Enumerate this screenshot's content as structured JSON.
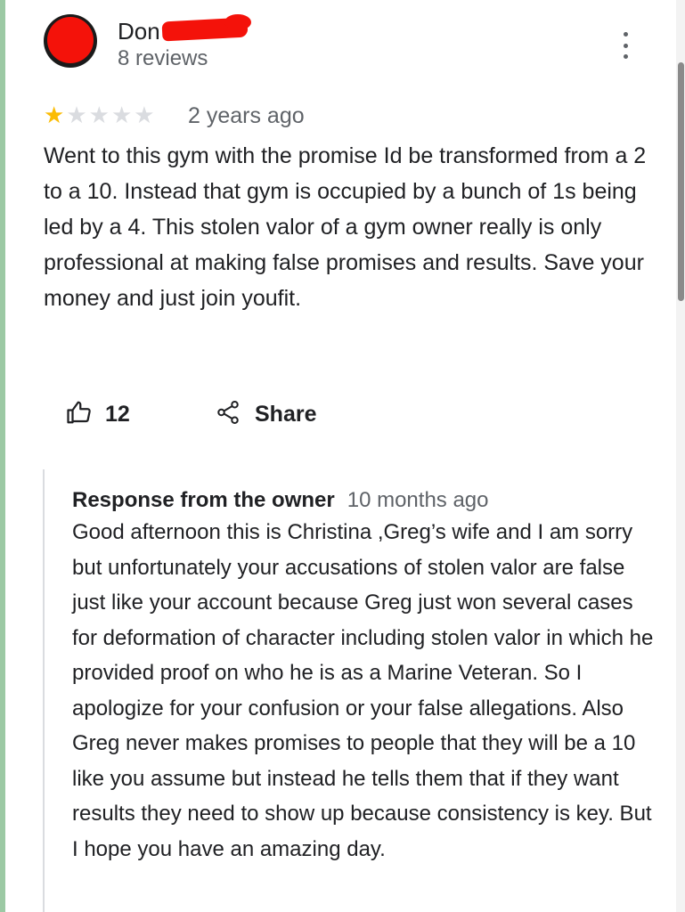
{
  "review": {
    "author_name": "Don",
    "review_count": "8 reviews",
    "rating": 1,
    "max_rating": 5,
    "time": "2 years ago",
    "text": "Went to this gym with the promise Id be transformed from a 2 to a 10. Instead that gym is occupied by a bunch of 1s being led by a 4. This stolen valor of a gym owner really is only professional at making false promises and results. Save your money and just join youfit."
  },
  "actions": {
    "like_count": "12",
    "share_label": "Share"
  },
  "owner_response": {
    "title": "Response from the owner",
    "time": "10 months ago",
    "text": "Good afternoon this is Christina ,Greg’s wife and I am sorry  but unfortunately your accusations of stolen valor are false just like your account because Greg just won several cases for deformation of character including stolen valor in which he provided proof on who he is as a Marine Veteran. So I apologize for your confusion or your false allegations. Also Greg never makes promises to people that they will be a 10 like you assume but instead he tells them that if they want results they need to show up because consistency is key. But I hope you have an amazing day."
  },
  "icons": {
    "avatar": "avatar",
    "more": "more-vert-icon",
    "star": "star-icon",
    "like": "thumb-up-icon",
    "share": "share-icon"
  },
  "colors": {
    "star_filled": "#fbbc04",
    "star_empty": "#dadce0",
    "redaction": "#f4120a",
    "secondary_text": "#5f6368"
  }
}
